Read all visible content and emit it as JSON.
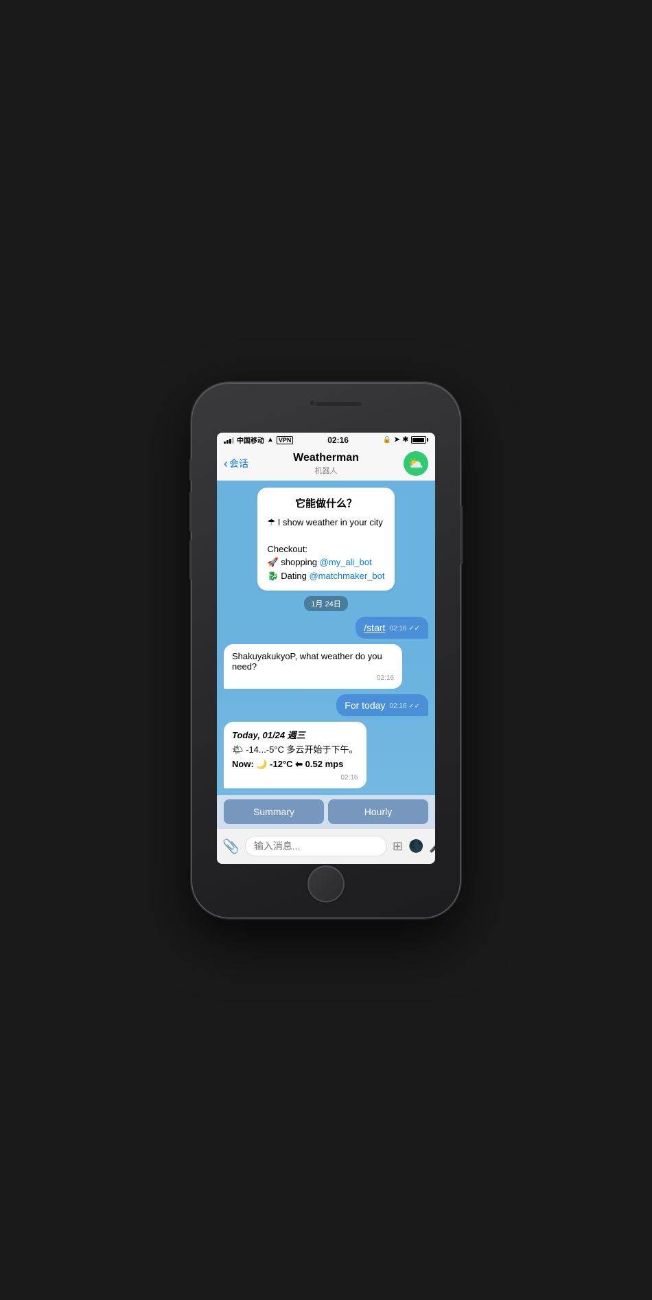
{
  "phone": {
    "status_bar": {
      "carrier": "中国移动",
      "wifi": "WiFi",
      "vpn": "VPN",
      "time": "02:16",
      "battery": "full"
    },
    "nav": {
      "back_label": "会话",
      "title": "Weatherman",
      "subtitle": "机器人",
      "avatar_emoji": "⛅"
    },
    "chat": {
      "welcome_title": "它能做什么？",
      "welcome_line1": "☂ I show weather in your city",
      "welcome_checkout": "Checkout:",
      "welcome_shopping": "🚀 shopping",
      "welcome_shopping_link": "@my_ali_bot",
      "welcome_dating": "🐉 Dating",
      "welcome_dating_link": "@matchmaker_bot",
      "date_badge": "1月 24日",
      "user_msg1": "/start",
      "user_msg1_time": "02:16",
      "bot_msg1": "ShakuyakukyoP, what weather do you need?",
      "bot_msg1_time": "02:16",
      "user_msg2": "For today",
      "user_msg2_time": "02:16",
      "bot_msg2_line1": "Today, 01/24 週三",
      "bot_msg2_line2": "🌤 -14...-5°C 多云开始于下午。",
      "bot_msg2_line3": "Now: 🌙 -12°C ⬅ 0.52 mps",
      "bot_msg2_time": "02:16"
    },
    "quick_replies": {
      "btn1": "Summary",
      "btn2": "Hourly"
    },
    "input": {
      "placeholder": "输入消息..."
    }
  }
}
